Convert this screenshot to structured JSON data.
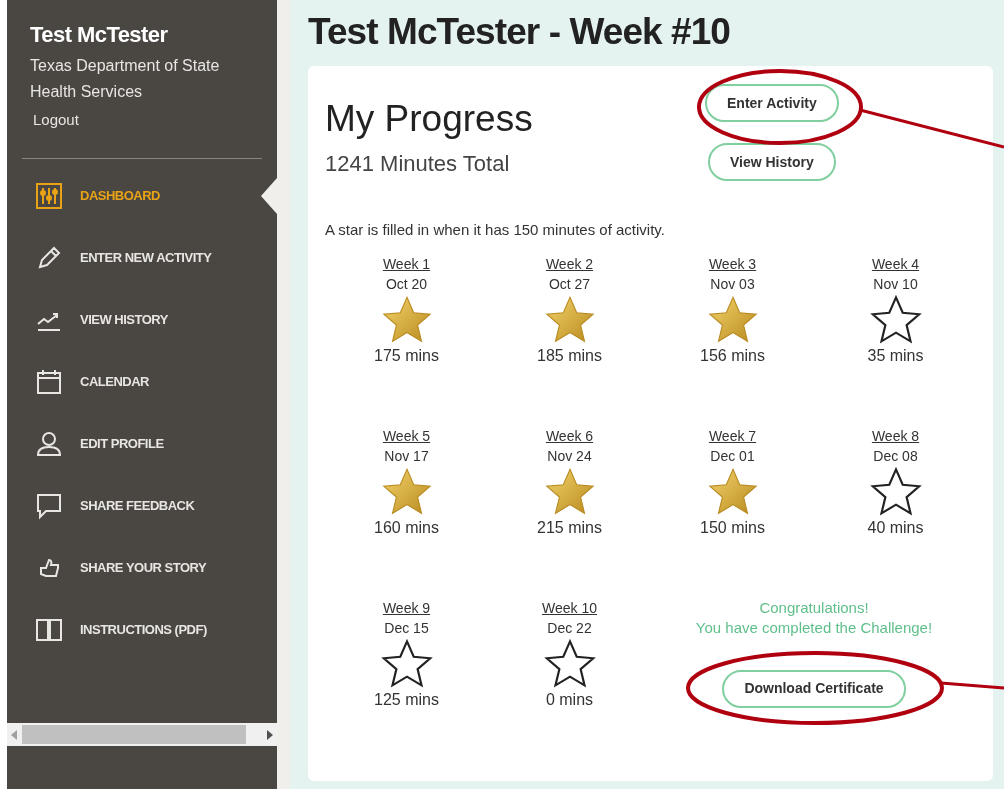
{
  "sidebar": {
    "user_name": "Test McTester",
    "organization": "Texas Department of State Health Services",
    "logout": "Logout",
    "items": [
      {
        "kind": "dashboard",
        "label": "DASHBOARD",
        "selected": true
      },
      {
        "kind": "pencil",
        "label": "ENTER NEW ACTIVITY",
        "selected": false
      },
      {
        "kind": "chart",
        "label": "VIEW HISTORY",
        "selected": false
      },
      {
        "kind": "calendar",
        "label": "CALENDAR",
        "selected": false
      },
      {
        "kind": "person",
        "label": "EDIT PROFILE",
        "selected": false
      },
      {
        "kind": "speech",
        "label": "SHARE FEEDBACK",
        "selected": false
      },
      {
        "kind": "thumb",
        "label": "SHARE YOUR STORY",
        "selected": false
      },
      {
        "kind": "book",
        "label": "INSTRUCTIONS (PDF)",
        "selected": false
      }
    ]
  },
  "page_title": "Test McTester - Week #10",
  "progress": {
    "title": "My Progress",
    "total": "1241 Minutes Total",
    "buttons": [
      "Enter Activity",
      "View History"
    ],
    "note": "A star is filled in when it has 150 minutes of activity.",
    "weeks": [
      {
        "week": "Week 1",
        "date": "Oct 20",
        "filled": true,
        "minutes": "175 mins"
      },
      {
        "week": "Week 2",
        "date": "Oct 27",
        "filled": true,
        "minutes": "185 mins"
      },
      {
        "week": "Week 3",
        "date": "Nov 03",
        "filled": true,
        "minutes": "156 mins"
      },
      {
        "week": "Week 4",
        "date": "Nov 10",
        "filled": false,
        "minutes": "35 mins"
      },
      {
        "week": "Week 5",
        "date": "Nov 17",
        "filled": true,
        "minutes": "160 mins"
      },
      {
        "week": "Week 6",
        "date": "Nov 24",
        "filled": true,
        "minutes": "215 mins"
      },
      {
        "week": "Week 7",
        "date": "Dec 01",
        "filled": true,
        "minutes": "150 mins"
      },
      {
        "week": "Week 8",
        "date": "Dec 08",
        "filled": false,
        "minutes": "40 mins"
      },
      {
        "week": "Week 9",
        "date": "Dec 15",
        "filled": false,
        "minutes": "125 mins"
      },
      {
        "week": "Week 10",
        "date": "Dec 22",
        "filled": false,
        "minutes": "0 mins"
      }
    ],
    "congratulations": [
      "Congratulations!",
      "You have completed the Challenge!"
    ],
    "certificate_button": "Download Certificate"
  }
}
